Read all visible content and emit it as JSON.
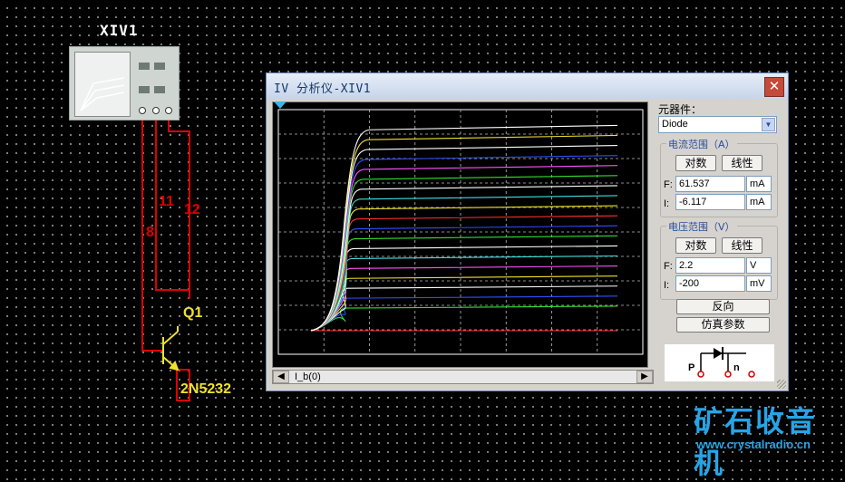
{
  "schematic": {
    "instrument_label": "XIV1",
    "wire_labels": [
      "8",
      "11",
      "12"
    ],
    "transistor_ref": "Q1",
    "transistor_part": "2N5232",
    "wire_color": "#e00000",
    "component_color": "#f0e030"
  },
  "window": {
    "title": "IV 分析仪-XIV1",
    "close_glyph": "✕",
    "plot": {
      "background": "#000000",
      "curve_count": 20
    },
    "scroll": {
      "left_arrow": "◀",
      "label": "I_b(0)",
      "right_arrow": "▶"
    },
    "panel": {
      "component_label": "元器件：",
      "component_value": "Diode",
      "current_range": {
        "title": "电流范围（A）",
        "log_btn": "对数",
        "lin_btn": "线性",
        "f_label": "F:",
        "f_value": "61.537",
        "f_unit": "mA",
        "i_label": "I:",
        "i_value": "-6.117",
        "i_unit": "mA"
      },
      "voltage_range": {
        "title": "电压范围（V）",
        "log_btn": "对数",
        "lin_btn": "线性",
        "f_label": "F:",
        "f_value": "2.2",
        "f_unit": "V",
        "i_label": "I:",
        "i_value": "-200",
        "i_unit": "mV"
      },
      "reverse_btn": "反向",
      "sim_params_btn": "仿真参数",
      "preview_pins": [
        "P",
        "n"
      ]
    }
  },
  "watermark": {
    "main": "矿石收音机",
    "url": "www.crystalradio.cn"
  }
}
